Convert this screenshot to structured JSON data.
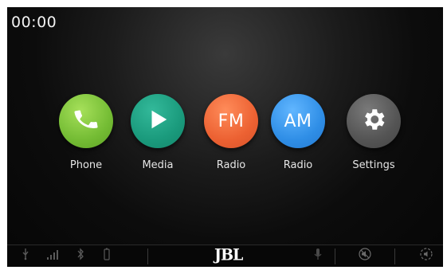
{
  "status": {
    "clock": "00:00"
  },
  "apps": [
    {
      "id": "phone",
      "label": "Phone"
    },
    {
      "id": "media",
      "label": "Media"
    },
    {
      "id": "fm",
      "icon_text": "FM",
      "label": "Radio"
    },
    {
      "id": "am",
      "icon_text": "AM",
      "label": "Radio"
    },
    {
      "id": "settings",
      "label": "Settings"
    }
  ],
  "bottombar": {
    "brand": "JBL",
    "icons": [
      "usb-icon",
      "signal-icon",
      "bluetooth-icon",
      "battery-icon",
      "microphone-icon",
      "mute-icon",
      "volume-icon"
    ]
  },
  "colors": {
    "phone": "#74bc34",
    "media": "#1a9a7c",
    "fm": "#ec6132",
    "am": "#2f8ee6",
    "settings": "#545454"
  }
}
